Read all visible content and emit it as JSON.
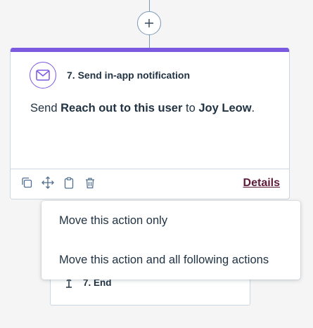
{
  "workflow": {
    "action": {
      "title": "7. Send in-app notification",
      "body_prefix": "Send ",
      "body_notification": "Reach out to this user",
      "body_middle": " to ",
      "body_recipient": "Joy Leow",
      "body_suffix": ".",
      "details_label": "Details",
      "icon": "envelope-icon",
      "toolbar_icons": [
        "clone-icon",
        "move-icon",
        "clipboard-icon",
        "delete-icon"
      ]
    },
    "end": {
      "label": "7. End"
    },
    "colors": {
      "accent": "#7b59e0",
      "text": "#213343",
      "link": "#5e1b3b",
      "border": "#cbd6e2",
      "connector": "#7c98b6"
    }
  },
  "move_menu": {
    "items": [
      "Move this action only",
      "Move this action and all following actions"
    ]
  }
}
